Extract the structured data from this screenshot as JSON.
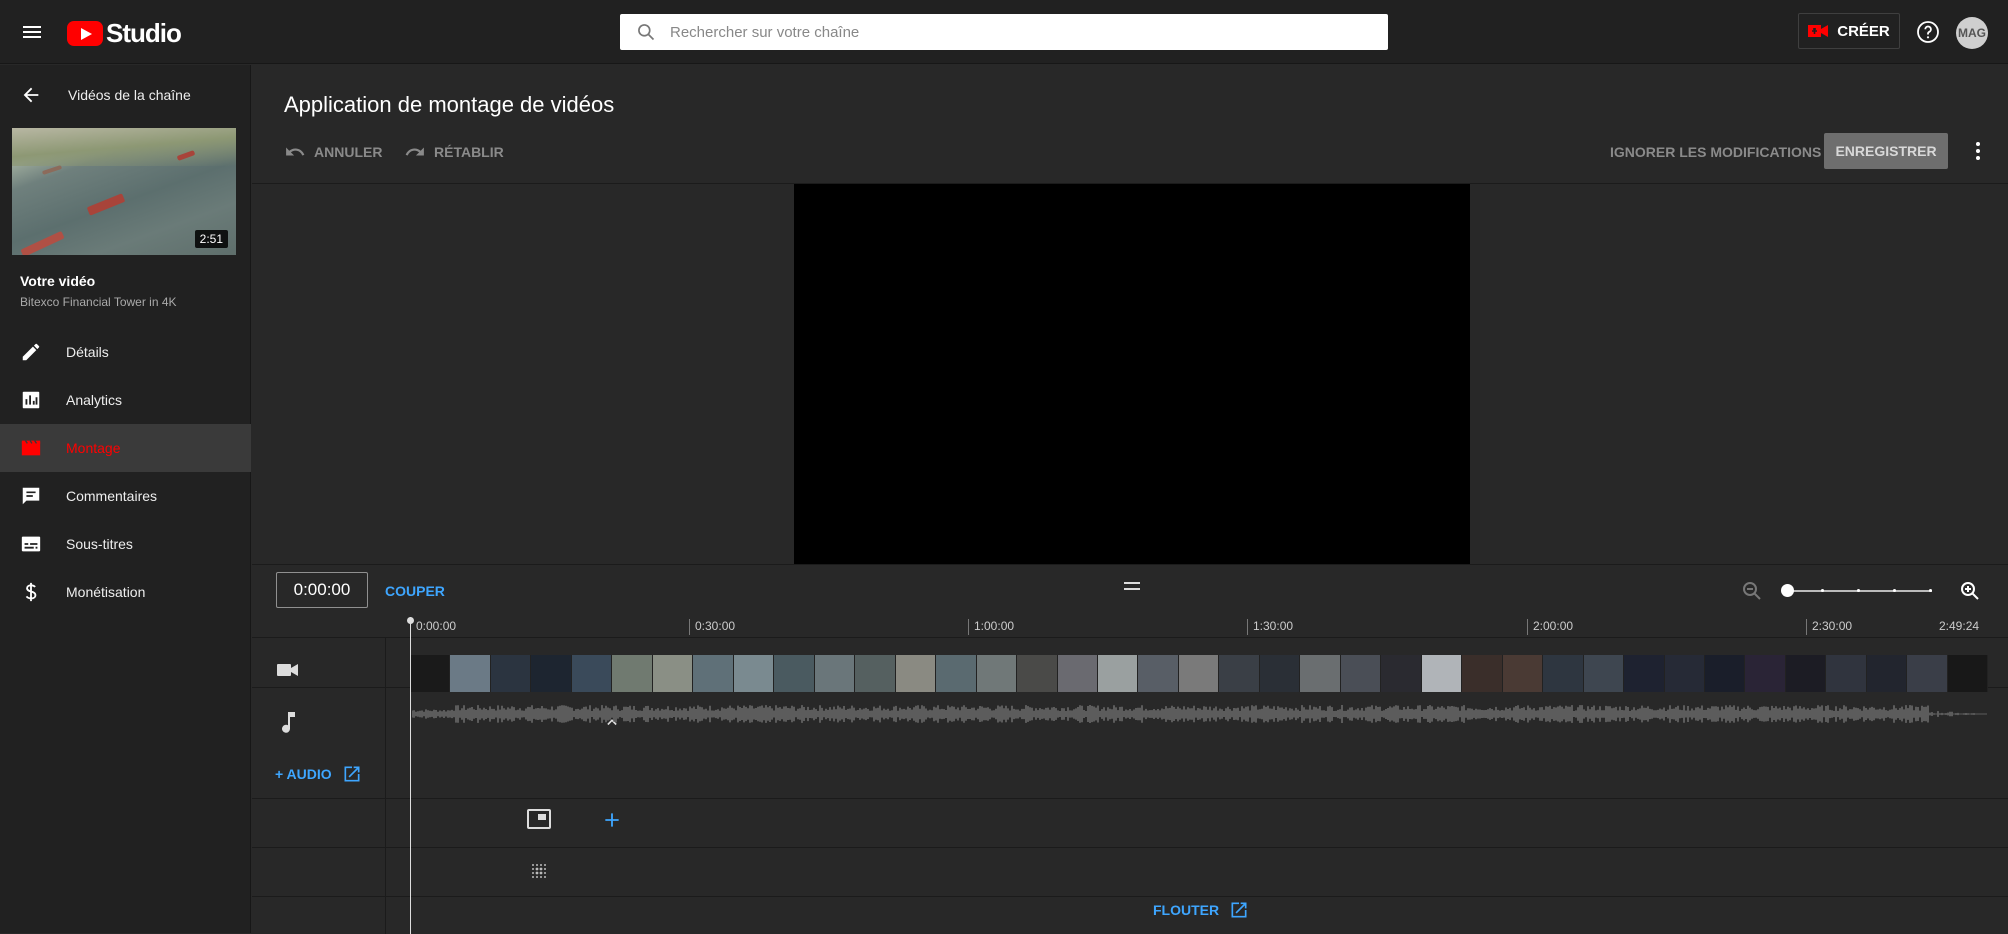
{
  "header": {
    "logo_text": "Studio",
    "search_placeholder": "Rechercher sur votre chaîne",
    "create_label": "CRÉER",
    "avatar_text": "MAG"
  },
  "sidebar": {
    "back_label": "Vidéos de la chaîne",
    "thumbnail_duration": "2:51",
    "your_video_label": "Votre vidéo",
    "video_title": "Bitexco Financial Tower in 4K",
    "items": [
      {
        "label": "Détails",
        "icon": "pencil-icon",
        "active": false
      },
      {
        "label": "Analytics",
        "icon": "analytics-icon",
        "active": false
      },
      {
        "label": "Montage",
        "icon": "clapperboard-icon",
        "active": true
      },
      {
        "label": "Commentaires",
        "icon": "comment-icon",
        "active": false
      },
      {
        "label": "Sous-titres",
        "icon": "subtitles-icon",
        "active": false
      },
      {
        "label": "Monétisation",
        "icon": "dollar-icon",
        "active": false
      }
    ]
  },
  "main": {
    "title": "Application de montage de vidéos",
    "undo_label": "ANNULER",
    "redo_label": "RÉTABLIR",
    "discard_label": "IGNORER LES MODIFICATIONS",
    "save_label": "ENREGISTRER"
  },
  "editor": {
    "timecode": "0:00:00",
    "cut_label": "COUPER",
    "ruler_labels": [
      "0:00:00",
      "0:30:00",
      "1:00:00",
      "1:30:00",
      "2:00:00",
      "2:30:00",
      "2:49:24"
    ],
    "add_audio_label": "+ AUDIO",
    "blur_label": "FLOUTER"
  },
  "colors": {
    "accent_red": "#ff0000",
    "link_blue": "#3ea6ff",
    "background": "#282828",
    "sidebar": "#212121"
  }
}
